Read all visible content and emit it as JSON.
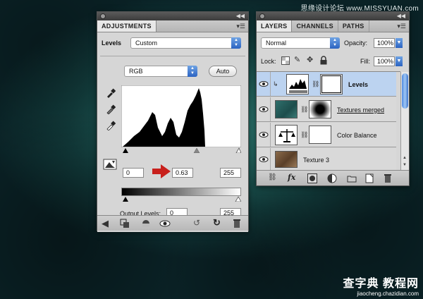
{
  "watermark": {
    "top": "思缘设计论坛 www.MISSYUAN.com",
    "bottom_big": "查字典 教程网",
    "bottom_small": "jiaocheng.chazidian.com"
  },
  "adjustments": {
    "tab": "ADJUSTMENTS",
    "preset_label": "Levels",
    "preset_value": "Custom",
    "channel_value": "RGB",
    "auto_label": "Auto",
    "input_black": "0",
    "input_gamma": "0.63",
    "input_white": "255",
    "output_label": "Output Levels:",
    "output_black": "0",
    "output_white": "255"
  },
  "layers_panel": {
    "tabs": [
      "LAYERS",
      "CHANNELS",
      "PATHS"
    ],
    "blend_mode": "Normal",
    "opacity_label": "Opacity:",
    "opacity_value": "100%",
    "lock_label": "Lock:",
    "fill_label": "Fill:",
    "fill_value": "100%",
    "layers": [
      {
        "name": "Levels",
        "selected": true
      },
      {
        "name": "Textures merged",
        "selected": false
      },
      {
        "name": "Color Balance",
        "selected": false
      },
      {
        "name": "Texture 3",
        "selected": false
      }
    ]
  },
  "colors": {
    "accent": "#2b63c2",
    "arrow_red": "#c8201c",
    "selection": "#bcd3f0"
  }
}
